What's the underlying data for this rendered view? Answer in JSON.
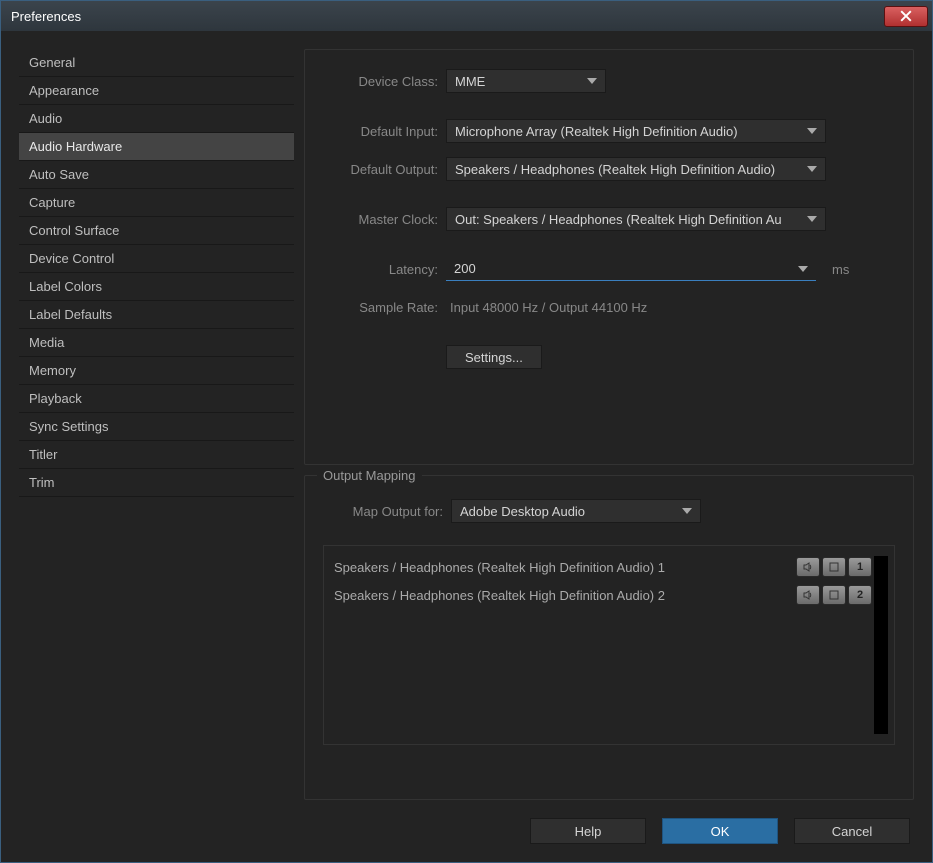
{
  "window": {
    "title": "Preferences"
  },
  "sidebar": {
    "items": [
      {
        "label": "General"
      },
      {
        "label": "Appearance"
      },
      {
        "label": "Audio"
      },
      {
        "label": "Audio Hardware",
        "selected": true
      },
      {
        "label": "Auto Save"
      },
      {
        "label": "Capture"
      },
      {
        "label": "Control Surface"
      },
      {
        "label": "Device Control"
      },
      {
        "label": "Label Colors"
      },
      {
        "label": "Label Defaults"
      },
      {
        "label": "Media"
      },
      {
        "label": "Memory"
      },
      {
        "label": "Playback"
      },
      {
        "label": "Sync Settings"
      },
      {
        "label": "Titler"
      },
      {
        "label": "Trim"
      }
    ]
  },
  "fields": {
    "device_class": {
      "label": "Device Class:",
      "value": "MME"
    },
    "default_input": {
      "label": "Default Input:",
      "value": "Microphone Array (Realtek High Definition Audio)"
    },
    "default_output": {
      "label": "Default Output:",
      "value": "Speakers / Headphones (Realtek High Definition Audio)"
    },
    "master_clock": {
      "label": "Master Clock:",
      "value": "Out: Speakers / Headphones (Realtek High Definition Au"
    },
    "latency": {
      "label": "Latency:",
      "value": "200",
      "suffix": "ms"
    },
    "sample_rate": {
      "label": "Sample Rate:",
      "value": "Input 48000 Hz / Output 44100 Hz"
    },
    "settings_btn": "Settings..."
  },
  "mapping": {
    "group_title": "Output Mapping",
    "map_for_label": "Map Output for:",
    "map_for_value": "Adobe Desktop Audio",
    "rows": [
      {
        "text": "Speakers / Headphones (Realtek High Definition Audio) 1",
        "num": "1"
      },
      {
        "text": "Speakers / Headphones (Realtek High Definition Audio) 2",
        "num": "2"
      }
    ]
  },
  "buttons": {
    "help": "Help",
    "ok": "OK",
    "cancel": "Cancel"
  }
}
